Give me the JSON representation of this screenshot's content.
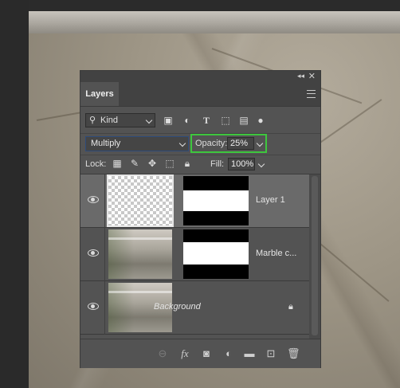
{
  "panel": {
    "title": "Layers",
    "collapse_icon": "double-chevron-left",
    "close_icon": "x"
  },
  "filter": {
    "kind_label": "Kind",
    "icons": [
      "image-filter-icon",
      "adjustment-filter-icon",
      "type-filter-icon",
      "shape-filter-icon",
      "smart-object-filter-icon",
      "toggle-filter-icon"
    ]
  },
  "blend": {
    "mode": "Multiply",
    "opacity_label": "Opacity:",
    "opacity_value": "25%",
    "highlight_color": "#3ec63e"
  },
  "lock": {
    "label": "Lock:",
    "fill_label": "Fill:",
    "fill_value": "100%"
  },
  "layers": [
    {
      "name": "Layer 1",
      "selected": true,
      "has_mask": true,
      "thumb": "transparent"
    },
    {
      "name": "Marble c...",
      "selected": false,
      "has_mask": true,
      "thumb": "photo"
    },
    {
      "name": "Background",
      "selected": false,
      "has_mask": false,
      "thumb": "photo",
      "locked": true
    }
  ],
  "footer_icons": [
    "link-icon",
    "fx-icon",
    "mask-icon",
    "adjustment-icon",
    "group-folder-icon",
    "new-layer-icon",
    "trash-icon"
  ]
}
